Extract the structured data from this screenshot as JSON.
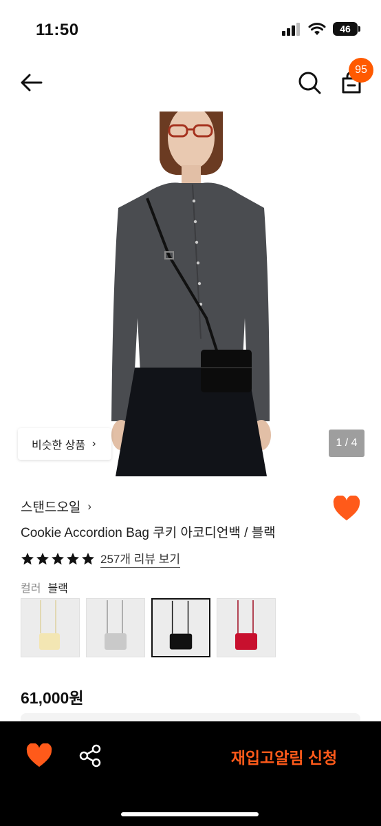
{
  "status_bar": {
    "time": "11:50",
    "battery": "46"
  },
  "nav": {
    "back_icon": "arrow-left-icon",
    "search_icon": "search-icon",
    "cart_icon": "shopping-bag-icon",
    "cart_count": "95"
  },
  "gallery": {
    "similar_label": "비슷한 상품",
    "chevron": "›",
    "page_indicator": "1 / 4"
  },
  "product": {
    "brand": "스탠드오일",
    "brand_chevron": "›",
    "name": "Cookie Accordion Bag 쿠키 아코디언백 / 블랙",
    "rating_stars": 5,
    "review_text": "257개 리뷰 보기",
    "color_label": "컬러",
    "color_value": "블랙",
    "price": "61,000원"
  },
  "swatches": [
    {
      "name": "cream",
      "color": "#f3e6b3",
      "selected": false
    },
    {
      "name": "silver",
      "color": "#c9c9c9",
      "selected": false
    },
    {
      "name": "black",
      "color": "#111111",
      "selected": true
    },
    {
      "name": "red",
      "color": "#c8102e",
      "selected": false
    }
  ],
  "bottom_bar": {
    "wishlist_icon": "heart-icon",
    "share_icon": "share-icon",
    "restock_label": "재입고알림 신청"
  },
  "colors": {
    "accent": "#ff5a00",
    "heart": "#ff5a1a",
    "bottom_bar_bg": "#000000"
  }
}
